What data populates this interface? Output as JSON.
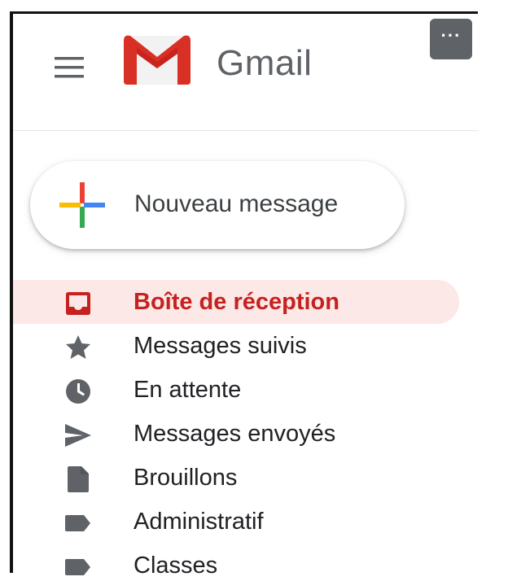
{
  "app": {
    "title": "Gmail",
    "more_button_label": "···"
  },
  "compose": {
    "label": "Nouveau message"
  },
  "nav": {
    "items": [
      {
        "label": "Boîte de réception",
        "icon": "inbox-icon",
        "active": true
      },
      {
        "label": "Messages suivis",
        "icon": "star-icon",
        "active": false
      },
      {
        "label": "En attente",
        "icon": "clock-icon",
        "active": false
      },
      {
        "label": "Messages envoyés",
        "icon": "send-icon",
        "active": false
      },
      {
        "label": "Brouillons",
        "icon": "draft-icon",
        "active": false
      },
      {
        "label": "Administratif",
        "icon": "label-icon",
        "active": false
      },
      {
        "label": "Classes",
        "icon": "label-icon",
        "active": false
      }
    ]
  },
  "colors": {
    "active_text": "#c5221f",
    "active_bg": "#fce8e6",
    "icon_gray": "#5f6368",
    "text_dark": "#202124"
  }
}
